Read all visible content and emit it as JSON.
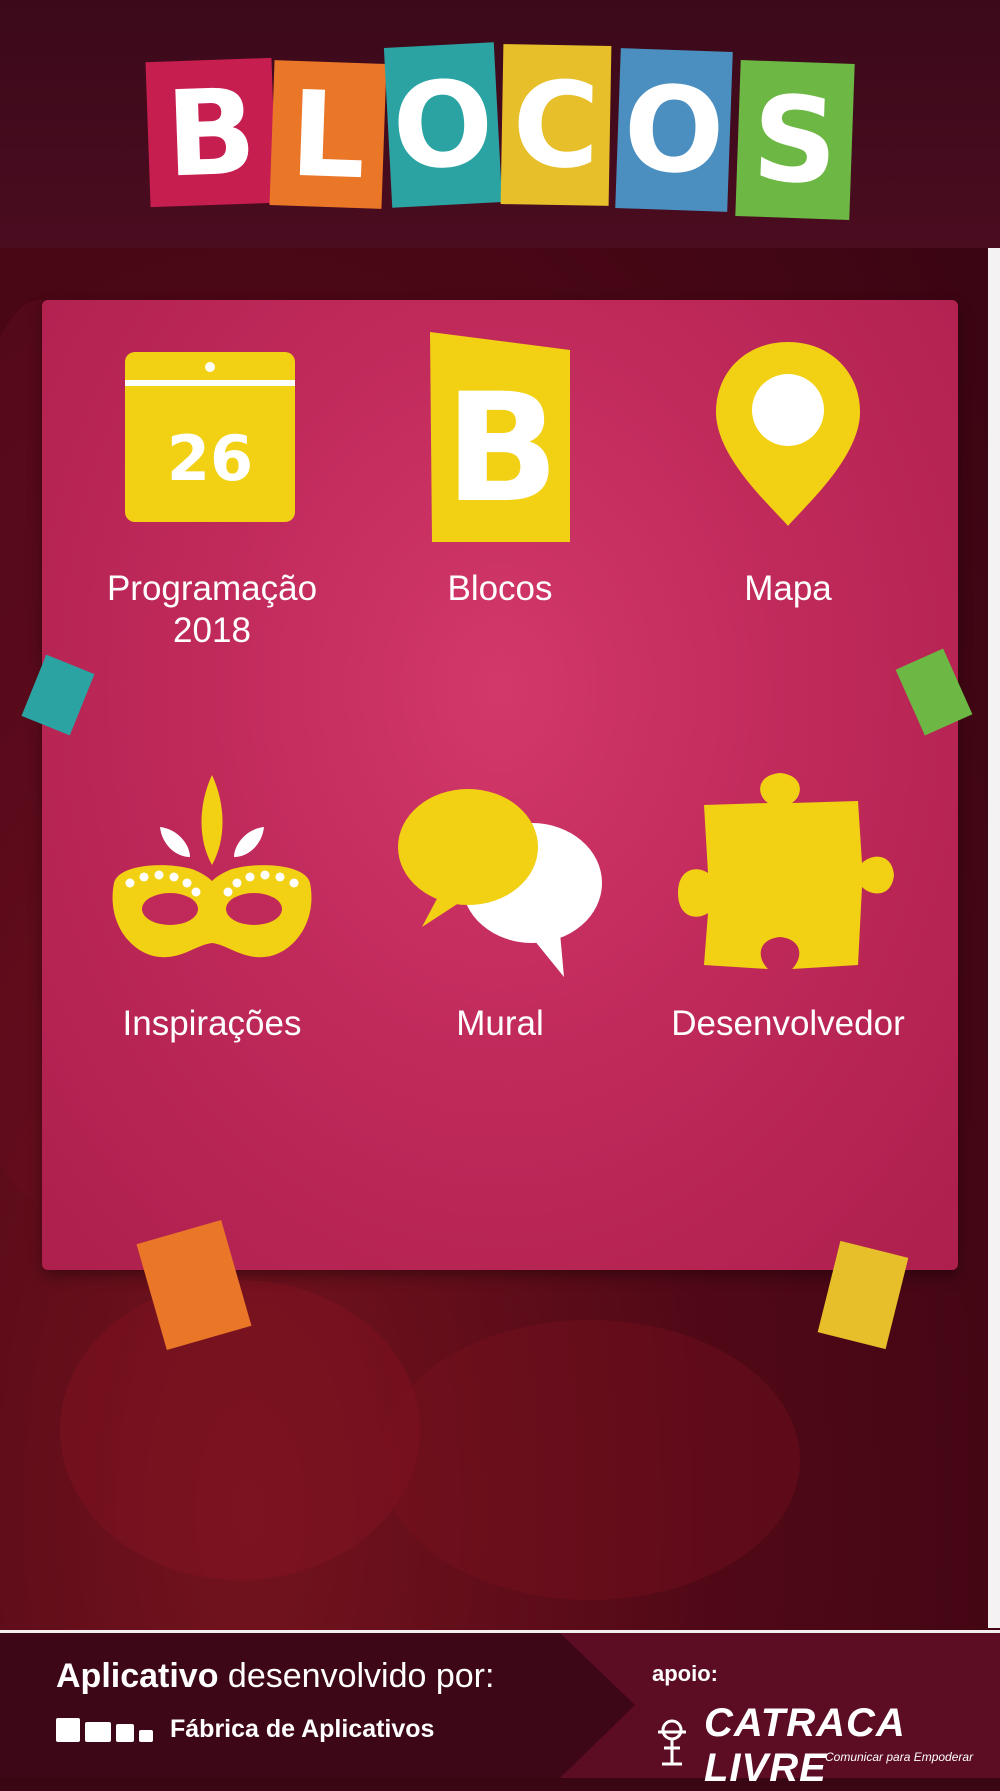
{
  "logo": {
    "letters": [
      "B",
      "L",
      "O",
      "C",
      "O",
      "S"
    ],
    "colors": [
      "#c71e50",
      "#ea7628",
      "#2ba3a3",
      "#e6bf2a",
      "#4a8fbf",
      "#6db744"
    ]
  },
  "menu": [
    {
      "label": "Programação\n2018",
      "icon": "calendar-icon",
      "calendar_day": "26"
    },
    {
      "label": "Blocos",
      "icon": "blocos-b-icon",
      "icon_letter": "B"
    },
    {
      "label": "Mapa",
      "icon": "map-pin-icon"
    },
    {
      "label": "Inspirações",
      "icon": "carnival-mask-icon"
    },
    {
      "label": "Mural",
      "icon": "chat-bubbles-icon"
    },
    {
      "label": "Desenvolvedor",
      "icon": "puzzle-piece-icon"
    }
  ],
  "footer": {
    "developed_bold": "Aplicativo",
    "developed_rest": " desenvolvido por:",
    "developer_name": "Fábrica de Aplicativos",
    "support_label": "apoio:",
    "sponsor_name": "CATRACA LIVRE",
    "sponsor_tagline": "Comunicar para Empoderar"
  },
  "colors": {
    "accent_yellow": "#f2d114",
    "panel_pink": "#c02a5b",
    "background": "#4a0a1c"
  }
}
